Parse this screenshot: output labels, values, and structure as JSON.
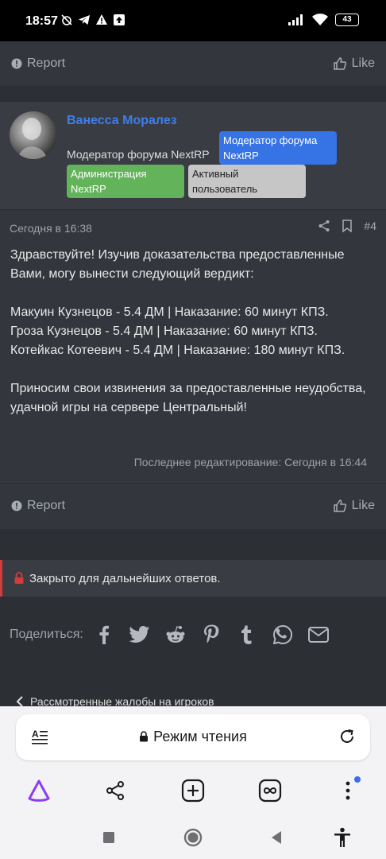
{
  "status_bar": {
    "time": "18:57",
    "battery": "43"
  },
  "top_footer": {
    "report": "Report",
    "like": "Like"
  },
  "post": {
    "author": "Ванесса Моралез",
    "user_title": "Модератор форума NextRP",
    "badges": {
      "moderator": "Модератор форума NextRP",
      "admin": "Администрация NextRP",
      "active": "Активный пользователь"
    },
    "date": "Сегодня в 16:38",
    "post_number": "#4",
    "body": {
      "p1": "Здравствуйте! Изучив доказательства предоставленные Вами, могу вынести следующий вердикт:",
      "line1": "Макуин Кузнецов - 5.4 ДМ | Наказание: 60 минут КПЗ.",
      "line2": "Гроза Кузнецов - 5.4 ДМ | Наказание: 60 минут КПЗ.",
      "line3": "Котейкас Котеевич - 5.4 ДМ | Наказание: 180 минут КПЗ.",
      "p3": "Приносим свои извинения за предоставленные неудобства, удачной игры на сервере Центральный!"
    },
    "edited": "Последнее редактирование: Сегодня в 16:44",
    "footer": {
      "report": "Report",
      "like": "Like"
    }
  },
  "closed_notice": "Закрыто для дальнейших ответов.",
  "share": {
    "label": "Поделиться:",
    "icons": [
      "facebook-icon",
      "twitter-icon",
      "reddit-icon",
      "pinterest-icon",
      "tumblr-icon",
      "whatsapp-icon",
      "email-icon"
    ]
  },
  "breadcrumb": "Рассмотренные жалобы на игроков",
  "browser": {
    "address_title": "Режим чтения",
    "toolbar_icons": [
      "alice-icon",
      "share-icon",
      "new-tab-icon",
      "tabs-icon",
      "more-icon"
    ]
  },
  "colors": {
    "accent_blue": "#3f7ee8",
    "badge_moderator": "#3673e4",
    "badge_admin": "#62b35a",
    "badge_active": "#c6c6c6",
    "closed_marker": "#d43b3b"
  }
}
